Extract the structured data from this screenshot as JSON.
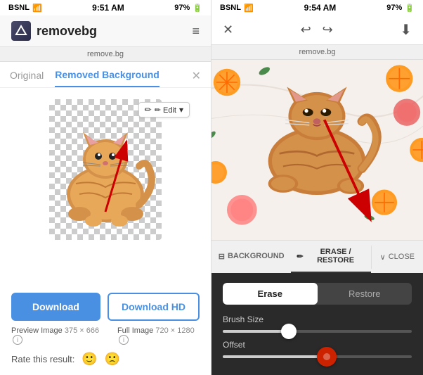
{
  "left": {
    "status": {
      "carrier": "BSNL",
      "time": "9:51 AM",
      "battery": "97%",
      "url": "remove.bg"
    },
    "logo": "removebg",
    "tabs": [
      "Original",
      "Removed Background"
    ],
    "active_tab": "Removed Background",
    "edit_button": "✏ Edit",
    "download_button": "Download",
    "download_hd_button": "Download HD",
    "preview_label": "Preview Image",
    "preview_size": "375 × 666",
    "full_label": "Full Image",
    "full_size": "720 × 1280",
    "rate_label": "Rate this result:"
  },
  "right": {
    "status": {
      "carrier": "BSNL",
      "time": "9:54 AM",
      "battery": "97%",
      "url": "remove.bg"
    },
    "toolbar_tabs": [
      "BACKGROUND",
      "ERASE / RESTORE"
    ],
    "close_label": "CLOSE",
    "erase_label": "Erase",
    "restore_label": "Restore",
    "brush_size_label": "Brush Size",
    "offset_label": "Offset",
    "brush_size_pct": 35,
    "offset_pct": 55
  }
}
